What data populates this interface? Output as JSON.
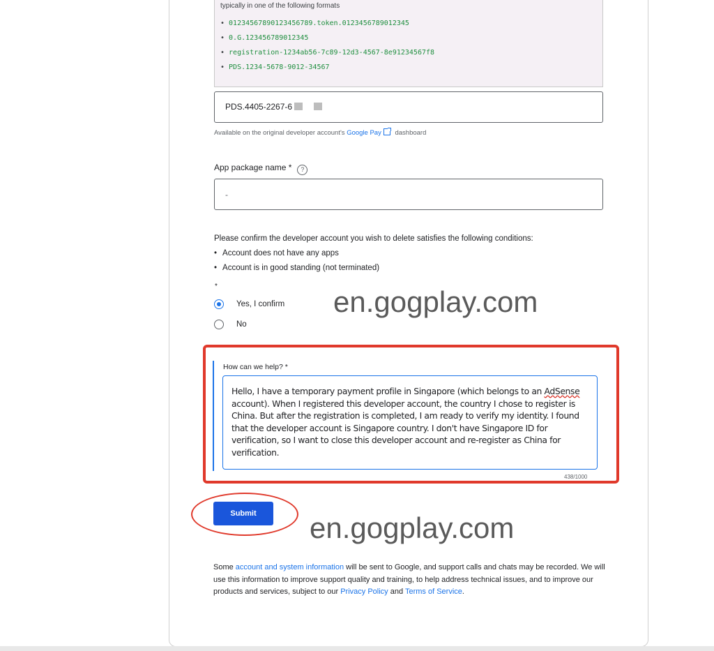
{
  "formats": {
    "intro": "typically in one of the following formats",
    "items": [
      "01234567890123456789.token.0123456789012345",
      "0.G.123456789012345",
      "registration-1234ab56-7c89-12d3-4567-8e91234567f8",
      "PDS.1234-5678-9012-34567"
    ]
  },
  "payments_id": {
    "value": "PDS.4405-2267-6",
    "helper_prefix": "Available on the original developer account's",
    "helper_link": "Google Pay",
    "helper_suffix": "dashboard"
  },
  "package": {
    "label": "App package name *",
    "help_icon": "?",
    "value": "-"
  },
  "confirm": {
    "question": "Please confirm the developer account you wish to delete satisfies the following conditions:",
    "conditions": [
      "Account does not have any apps",
      "Account is in good standing (not terminated)"
    ],
    "required_mark": "*",
    "options": [
      {
        "label": "Yes, I confirm",
        "selected": true
      },
      {
        "label": "No",
        "selected": false
      }
    ]
  },
  "help": {
    "label": "How can we help? *",
    "message_before": "Hello, I have a temporary payment profile in Singapore (which belongs to an ",
    "message_underlined": "AdSense",
    "message_after": " account). When I registered this developer account, the country I chose to register is China. But after the registration is completed, I am ready to verify my identity. I found that the developer account is Singapore country. I don't have Singapore ID for verification, so I want to close this developer account and re-register as China for verification.",
    "char_count": "438/1000"
  },
  "submit_label": "Submit",
  "footer": {
    "t1": "Some ",
    "link1": "account and system information",
    "t2": " will be sent to Google, and support calls and chats may be recorded. We will use this information to improve support quality and training, to help address technical issues, and to improve our products and services, subject to our ",
    "link2": "Privacy Policy",
    "t3": " and ",
    "link3": "Terms of Service",
    "t4": "."
  },
  "watermarks": [
    "en.gogplay.com",
    "en.gogplay.com"
  ],
  "colors": {
    "accent": "#1a73e8",
    "submit": "#1a56db",
    "annotation_red": "#e0392b",
    "format_green": "#1e8e3e"
  }
}
